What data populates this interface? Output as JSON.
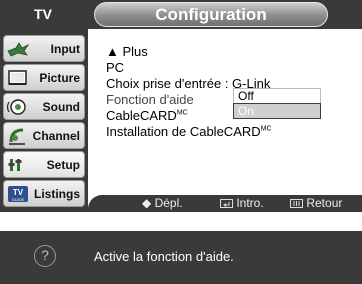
{
  "header": {
    "source": "TV",
    "title": "Configuration"
  },
  "sidebar": {
    "items": [
      {
        "label": "Input",
        "icon": "input-icon"
      },
      {
        "label": "Picture",
        "icon": "picture-icon"
      },
      {
        "label": "Sound",
        "icon": "sound-icon"
      },
      {
        "label": "Channel",
        "icon": "channel-icon"
      },
      {
        "label": "Setup",
        "icon": "setup-icon",
        "active": true
      },
      {
        "label": "Listings",
        "icon": "listings-icon"
      }
    ]
  },
  "menu": {
    "more": "▲ Plus",
    "pc": "PC",
    "input_choice": "Choix prise d'entrée : G-Link",
    "help_function": "Fonction d'aide",
    "cablecard": "CableCARD",
    "cablecard_sup": "MC",
    "cablecard_install": "Installation de CableCARD",
    "cablecard_install_sup": "MC",
    "options": [
      "Off",
      "On"
    ],
    "selected_option": "On"
  },
  "nav": {
    "move": "◆ Dépl.",
    "enter": "Intro.",
    "return": "Retour"
  },
  "help": {
    "text": "Active la fonction d'aide."
  },
  "colors": {
    "dark_bg": "#3a3a3a",
    "highlight": "#cfcfcf"
  }
}
